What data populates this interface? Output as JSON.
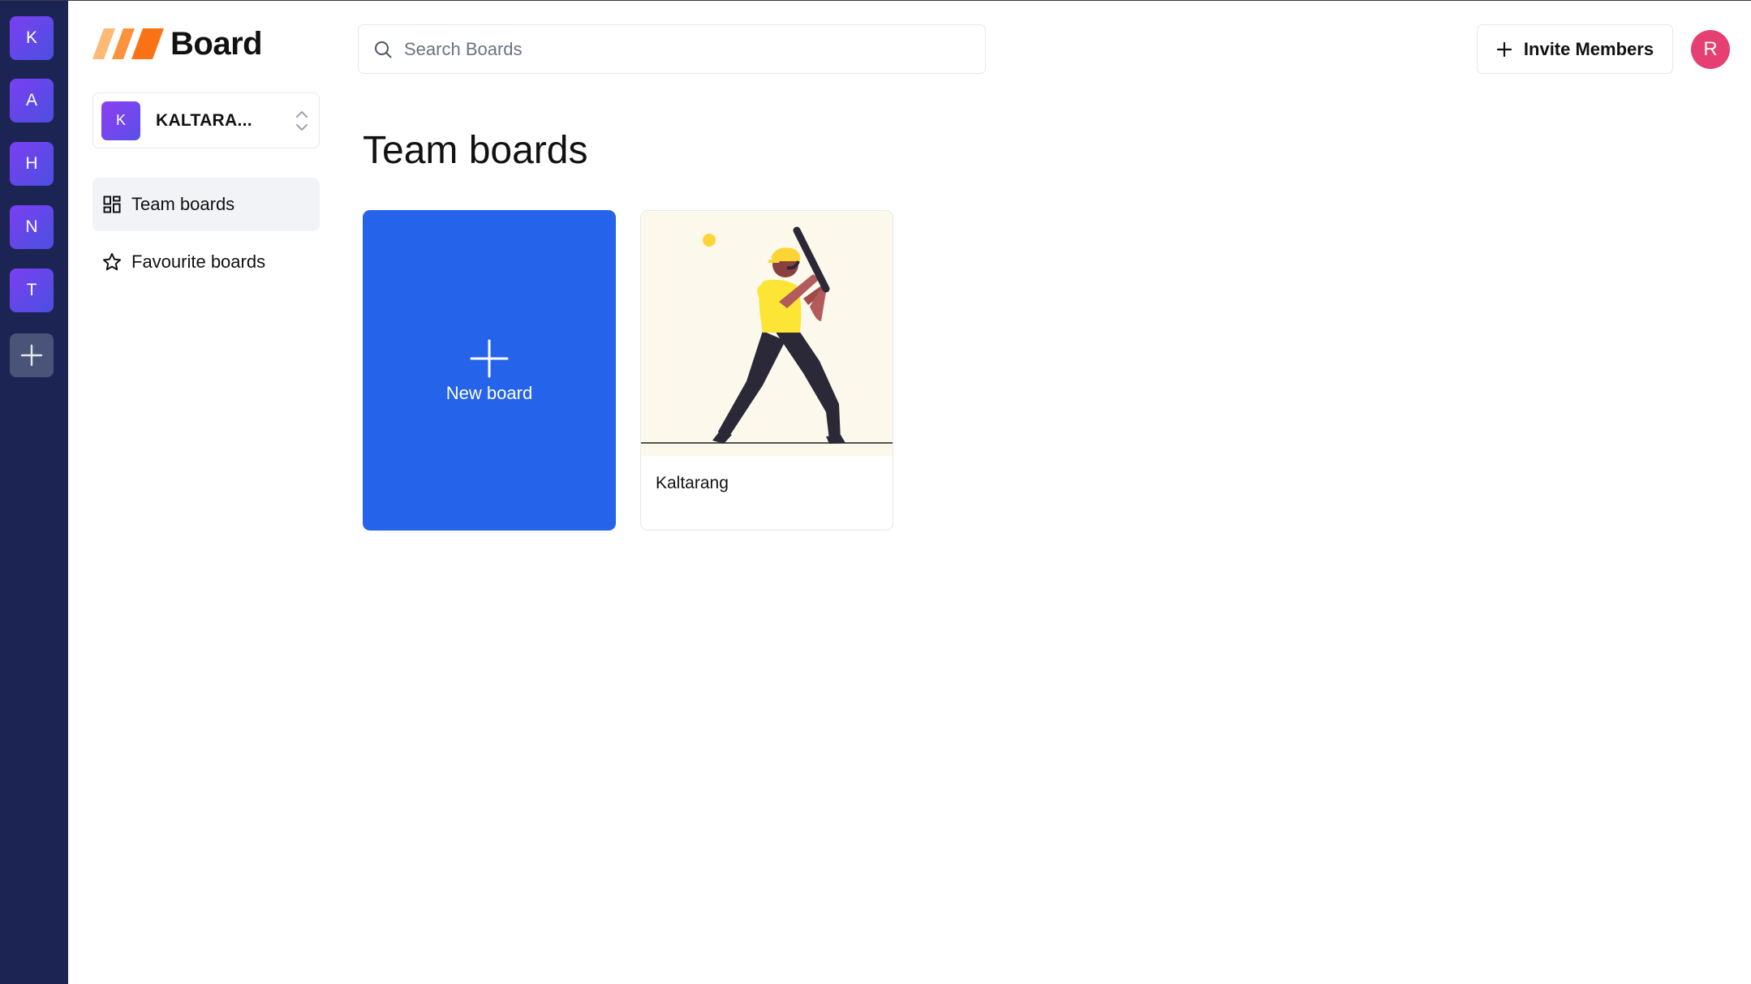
{
  "app": {
    "logo_text": "Board"
  },
  "org_rail": {
    "orgs": [
      {
        "initial": "K"
      },
      {
        "initial": "A"
      },
      {
        "initial": "H"
      },
      {
        "initial": "N"
      },
      {
        "initial": "T"
      }
    ],
    "add_icon": "plus-icon"
  },
  "org_switcher": {
    "initial": "K",
    "name": "KALTARA...",
    "icon": "chevron-up-down-icon"
  },
  "sidebar": {
    "items": [
      {
        "label": "Team boards",
        "icon": "dashboard-grid-icon",
        "active": true
      },
      {
        "label": "Favourite boards",
        "icon": "star-icon",
        "active": false
      }
    ]
  },
  "header": {
    "search": {
      "placeholder": "Search Boards",
      "value": ""
    },
    "invite_label": "Invite Members",
    "avatar_initial": "R"
  },
  "main": {
    "title": "Team boards",
    "new_board_label": "New board",
    "boards": [
      {
        "title": "Kaltarang",
        "image": "baseball-batter-illustration"
      }
    ]
  },
  "colors": {
    "rail_bg": "#1c2453",
    "primary": "#2563eb",
    "avatar": "#e63f73",
    "logo_orange": "#f97316",
    "card_art_bg": "#fcf9ec"
  }
}
